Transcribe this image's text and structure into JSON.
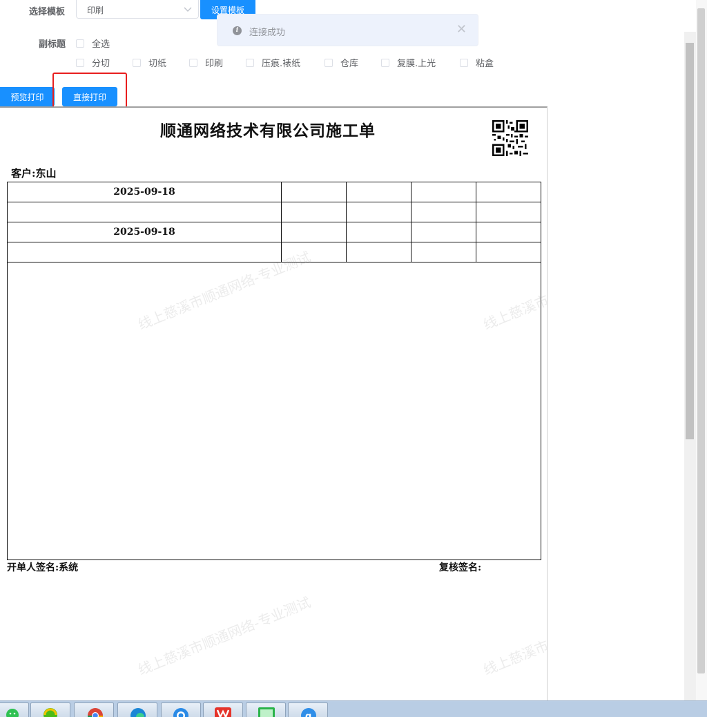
{
  "form": {
    "template_label": "选择模板",
    "template_value": "印刷",
    "set_template_label": "设置模板",
    "subtitle_label": "副标题",
    "select_all_label": "全选",
    "options": [
      "分切",
      "切纸",
      "印刷",
      "压痕.裱纸",
      "仓库",
      "复膜.上光",
      "粘盒"
    ]
  },
  "toast": {
    "message": "连接成功"
  },
  "actions": {
    "preview_label": "预览打印",
    "direct_label": "直接打印"
  },
  "doc": {
    "title": "顺通网络技术有限公司施工单",
    "customer": "客户:东山",
    "rows": [
      [
        "2025-09-18",
        "",
        "",
        "",
        ""
      ],
      [
        "",
        "",
        "",
        "",
        ""
      ],
      [
        "2025-09-18",
        "",
        "",
        "",
        ""
      ],
      [
        "",
        "",
        "",
        "",
        ""
      ]
    ],
    "issuer_signature": "开单人签名:系统",
    "reviewer_signature": "复核签名:",
    "watermark": "线上慈溪市顺通网络-专业测试"
  },
  "colors": {
    "primary": "#1890ff",
    "highlight": "#e81e1e",
    "toast_bg": "#edf2fc"
  },
  "taskbar_icons": [
    "wechat-icon",
    "browser-360-icon",
    "chrome-icon",
    "edge-icon",
    "qq-browser-icon",
    "wps-icon",
    "screen-app-icon",
    "g-app-icon"
  ]
}
